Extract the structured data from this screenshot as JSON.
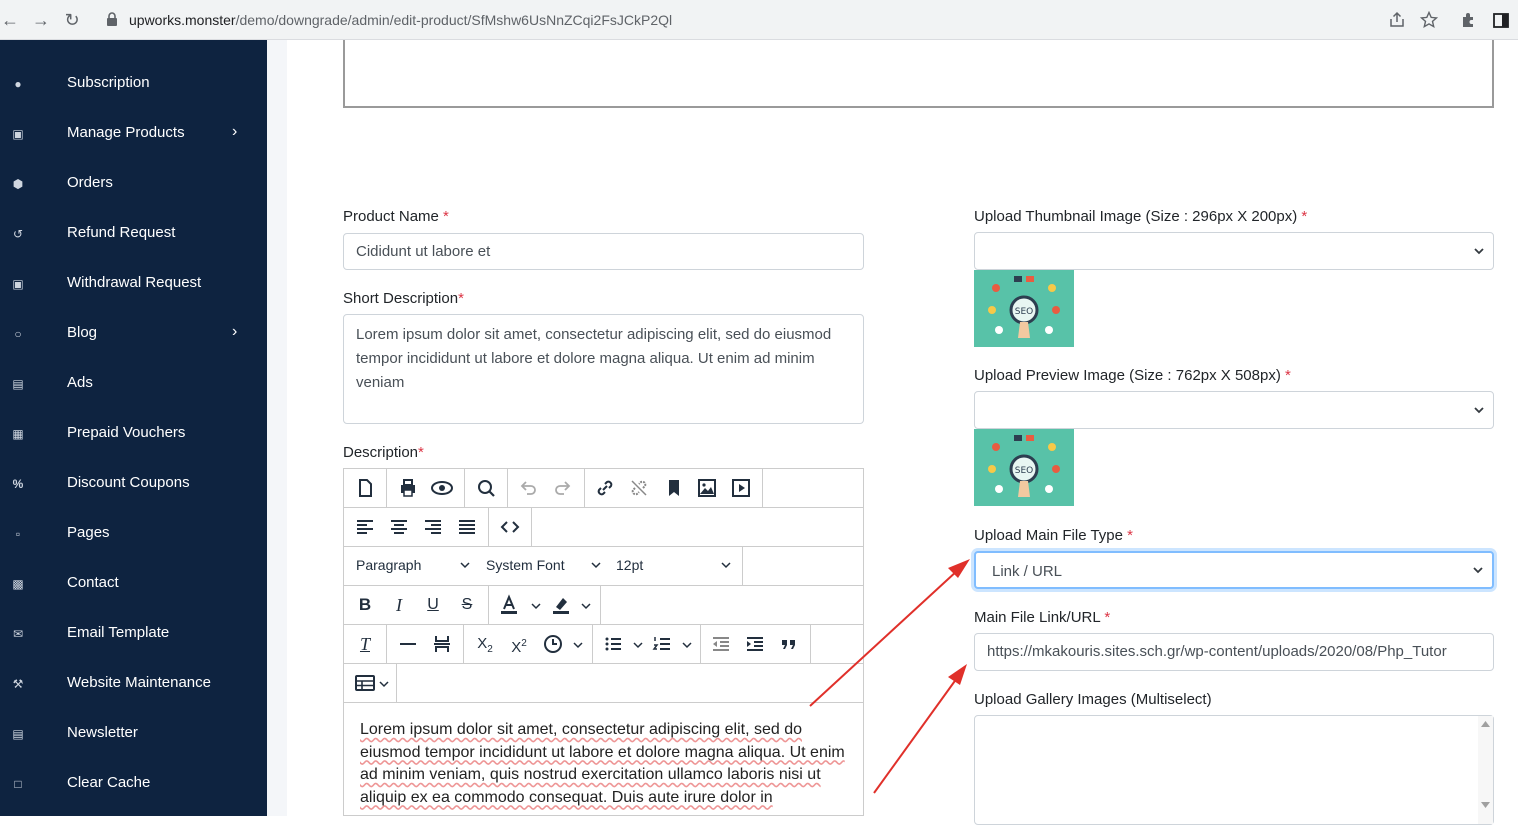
{
  "browser": {
    "url_host": "upworks.monster",
    "url_path": "/demo/downgrade/admin/edit-product/SfMshw6UsNnZCqi2FsJCkP2Ql"
  },
  "sidebar": {
    "items": [
      {
        "label": "Subscription",
        "icon": "user-icon",
        "chevron": false
      },
      {
        "label": "Manage Products",
        "icon": "cart-icon",
        "chevron": true
      },
      {
        "label": "Orders",
        "icon": "box-icon",
        "chevron": false
      },
      {
        "label": "Refund Request",
        "icon": "undo-icon",
        "chevron": false
      },
      {
        "label": "Withdrawal Request",
        "icon": "money-icon",
        "chevron": false
      },
      {
        "label": "Blog",
        "icon": "comments-icon",
        "chevron": true
      },
      {
        "label": "Ads",
        "icon": "image-icon",
        "chevron": false
      },
      {
        "label": "Prepaid Vouchers",
        "icon": "gift-icon",
        "chevron": false
      },
      {
        "label": "Discount Coupons",
        "icon": "percent-icon",
        "chevron": false
      },
      {
        "label": "Pages",
        "icon": "file-icon",
        "chevron": false
      },
      {
        "label": "Contact",
        "icon": "contact-icon",
        "chevron": false
      },
      {
        "label": "Email Template",
        "icon": "envelope-icon",
        "chevron": false
      },
      {
        "label": "Website Maintenance",
        "icon": "wrench-icon",
        "chevron": false
      },
      {
        "label": "Newsletter",
        "icon": "newspaper-icon",
        "chevron": false
      },
      {
        "label": "Clear Cache",
        "icon": "trash-icon",
        "chevron": false
      }
    ]
  },
  "form": {
    "product_name_label": "Product Name",
    "product_name_value": "Cididunt ut labore et",
    "short_desc_label": "Short Description",
    "short_desc_value": "Lorem ipsum dolor sit amet, consectetur adipiscing elit, sed do eiusmod tempor incididunt ut labore et dolore magna aliqua. Ut enim ad minim veniam",
    "description_label": "Description",
    "thumbnail_label": "Upload Thumbnail Image (Size : 296px X 200px)",
    "preview_label": "Upload Preview Image (Size : 762px X 508px)",
    "main_file_type_label": "Upload Main File Type",
    "main_file_type_value": "Link / URL",
    "main_file_link_label": "Main File Link/URL",
    "main_file_link_value": "https://mkakouris.sites.sch.gr/wp-content/uploads/2020/08/Php_Tutor",
    "gallery_label": "Upload Gallery Images (Multiselect)",
    "required_mark": "*"
  },
  "editor": {
    "format_value": "Paragraph",
    "font_value": "System Font",
    "size_value": "12pt",
    "body_text": "Lorem ipsum dolor sit amet, consectetur adipiscing elit, sed do eiusmod tempor incididunt ut labore et dolore magna aliqua. Ut enim ad minim veniam, quis nostrud exercitation ullamco laboris nisi ut aliquip ex ea commodo consequat. Duis aute irure dolor in"
  },
  "colors": {
    "sidebar_bg": "#0e2340",
    "required": "#dc3545",
    "annotation_arrow": "#e0302a",
    "thumb_bg": "#58c2a8"
  }
}
